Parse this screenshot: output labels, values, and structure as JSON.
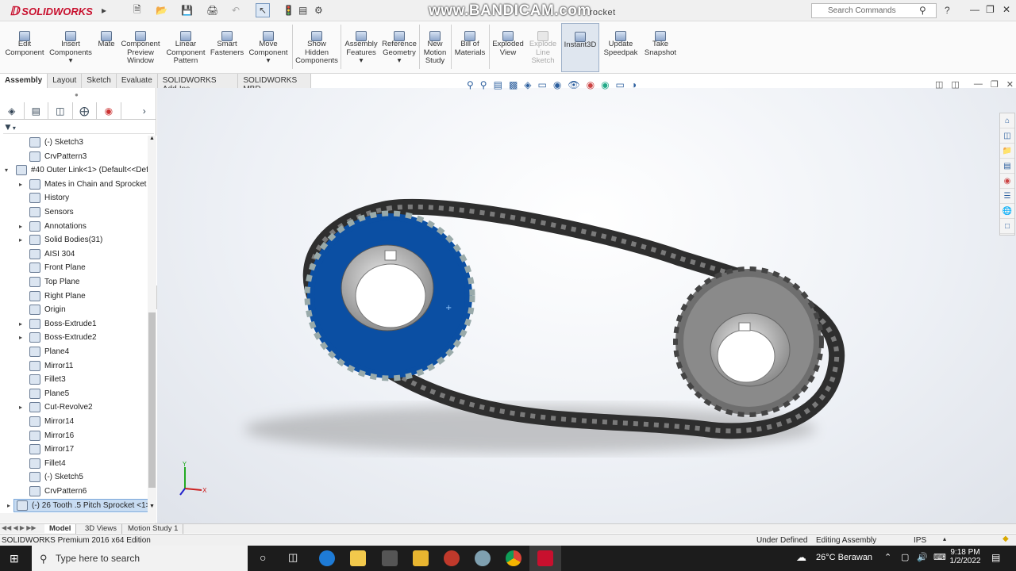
{
  "app": {
    "brand": "SOLIDWORKS",
    "watermark": "www.BANDICAM.com",
    "doc_title_fragment": "rocket",
    "search_placeholder": "Search Commands"
  },
  "ribbon": [
    {
      "label": "Edit Component"
    },
    {
      "label": "Insert Components"
    },
    {
      "label": "Mate"
    },
    {
      "label": "Component Preview Window"
    },
    {
      "label": "Linear Component Pattern"
    },
    {
      "label": "Smart Fasteners"
    },
    {
      "label": "Move Component"
    },
    {
      "label": "Show Hidden Components"
    },
    {
      "label": "Assembly Features"
    },
    {
      "label": "Reference Geometry"
    },
    {
      "label": "New Motion Study"
    },
    {
      "label": "Bill of Materials"
    },
    {
      "label": "Exploded View"
    },
    {
      "label": "Explode Line Sketch"
    },
    {
      "label": "Instant3D"
    },
    {
      "label": "Update Speedpak"
    },
    {
      "label": "Take Snapshot"
    }
  ],
  "tabs": [
    "Assembly",
    "Layout",
    "Sketch",
    "Evaluate",
    "SOLIDWORKS Add-Ins",
    "SOLIDWORKS MBD"
  ],
  "tree": [
    {
      "label": "(-) Sketch3"
    },
    {
      "label": "CrvPattern3"
    },
    {
      "label": "#40 Outer Link<1> (Default<<Defa"
    },
    {
      "label": "Mates in Chain and Sprocket"
    },
    {
      "label": "History"
    },
    {
      "label": "Sensors"
    },
    {
      "label": "Annotations"
    },
    {
      "label": "Solid Bodies(31)"
    },
    {
      "label": "AISI 304"
    },
    {
      "label": "Front Plane"
    },
    {
      "label": "Top Plane"
    },
    {
      "label": "Right Plane"
    },
    {
      "label": "Origin"
    },
    {
      "label": "Boss-Extrude1"
    },
    {
      "label": "Boss-Extrude2"
    },
    {
      "label": "Plane4"
    },
    {
      "label": "Mirror11"
    },
    {
      "label": "Fillet3"
    },
    {
      "label": "Plane5"
    },
    {
      "label": "Cut-Revolve2"
    },
    {
      "label": "Mirror14"
    },
    {
      "label": "Mirror16"
    },
    {
      "label": "Mirror17"
    },
    {
      "label": "Fillet4"
    },
    {
      "label": "(-) Sketch5"
    },
    {
      "label": "CrvPattern6"
    },
    {
      "label": "(-) 26 Tooth .5 Pitch Sprocket <1>"
    }
  ],
  "bottom_tabs": [
    "Model",
    "3D Views",
    "Motion Study 1"
  ],
  "status": {
    "edition": "SOLIDWORKS Premium 2016 x64 Edition",
    "state": "Under Defined",
    "mode": "Editing Assembly",
    "units": "IPS"
  },
  "taskbar": {
    "search_placeholder": "Type here to search",
    "weather": "26°C  Berawan",
    "time": "9:18 PM",
    "date": "1/2/2022"
  },
  "colors": {
    "sprocket_selected": "#0b4fa3",
    "chain": "#3a3a3a",
    "sprocket": "#8a8a8a"
  }
}
